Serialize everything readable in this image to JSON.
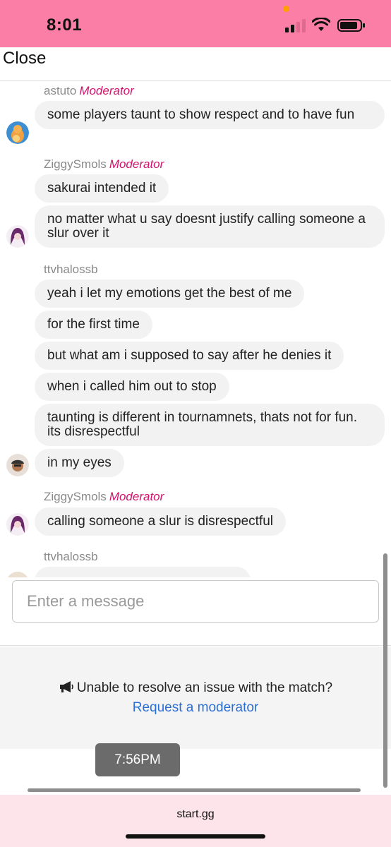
{
  "status_bar": {
    "time": "8:01",
    "color": "#fb7ea6"
  },
  "header": {
    "close_label": "Close"
  },
  "messages": [
    {
      "sender": "astuto",
      "role": "Moderator",
      "bubbles": [
        "some players taunt to show respect and to have fun"
      ],
      "avatar": "dragon-avatar"
    },
    {
      "sender": "ZiggySmols",
      "role": "Moderator",
      "bubbles": [
        "sakurai intended it",
        "no matter what u say doesnt justify calling someone a slur over it"
      ],
      "avatar": "purple-hair-avatar"
    },
    {
      "sender": "ttvhalossb",
      "role": "",
      "bubbles": [
        "yeah i let my emotions get the best of me",
        "for the first time",
        "but what am i supposed to say after he denies it",
        "when i called him out to stop",
        "taunting is different in tournamnets, thats not for fun. its disrespectful",
        "in my eyes"
      ],
      "avatar": "person-avatar"
    },
    {
      "sender": "ZiggySmols",
      "role": "Moderator",
      "bubbles": [
        "calling someone a slur is disrespectful"
      ],
      "avatar": "purple-hair-avatar"
    },
    {
      "sender": "ttvhalossb",
      "role": "",
      "bubbles": [],
      "avatar": "person-avatar"
    }
  ],
  "input": {
    "placeholder": "Enter a message"
  },
  "issue": {
    "text": "Unable to resolve an issue with the match?",
    "link": "Request a moderator"
  },
  "timestamp_chip": "7:56PM",
  "browser": {
    "domain": "start.gg"
  },
  "colors": {
    "moderator": "#d1136e",
    "link": "#2b6fd6",
    "bubble": "#f2f2f3"
  }
}
